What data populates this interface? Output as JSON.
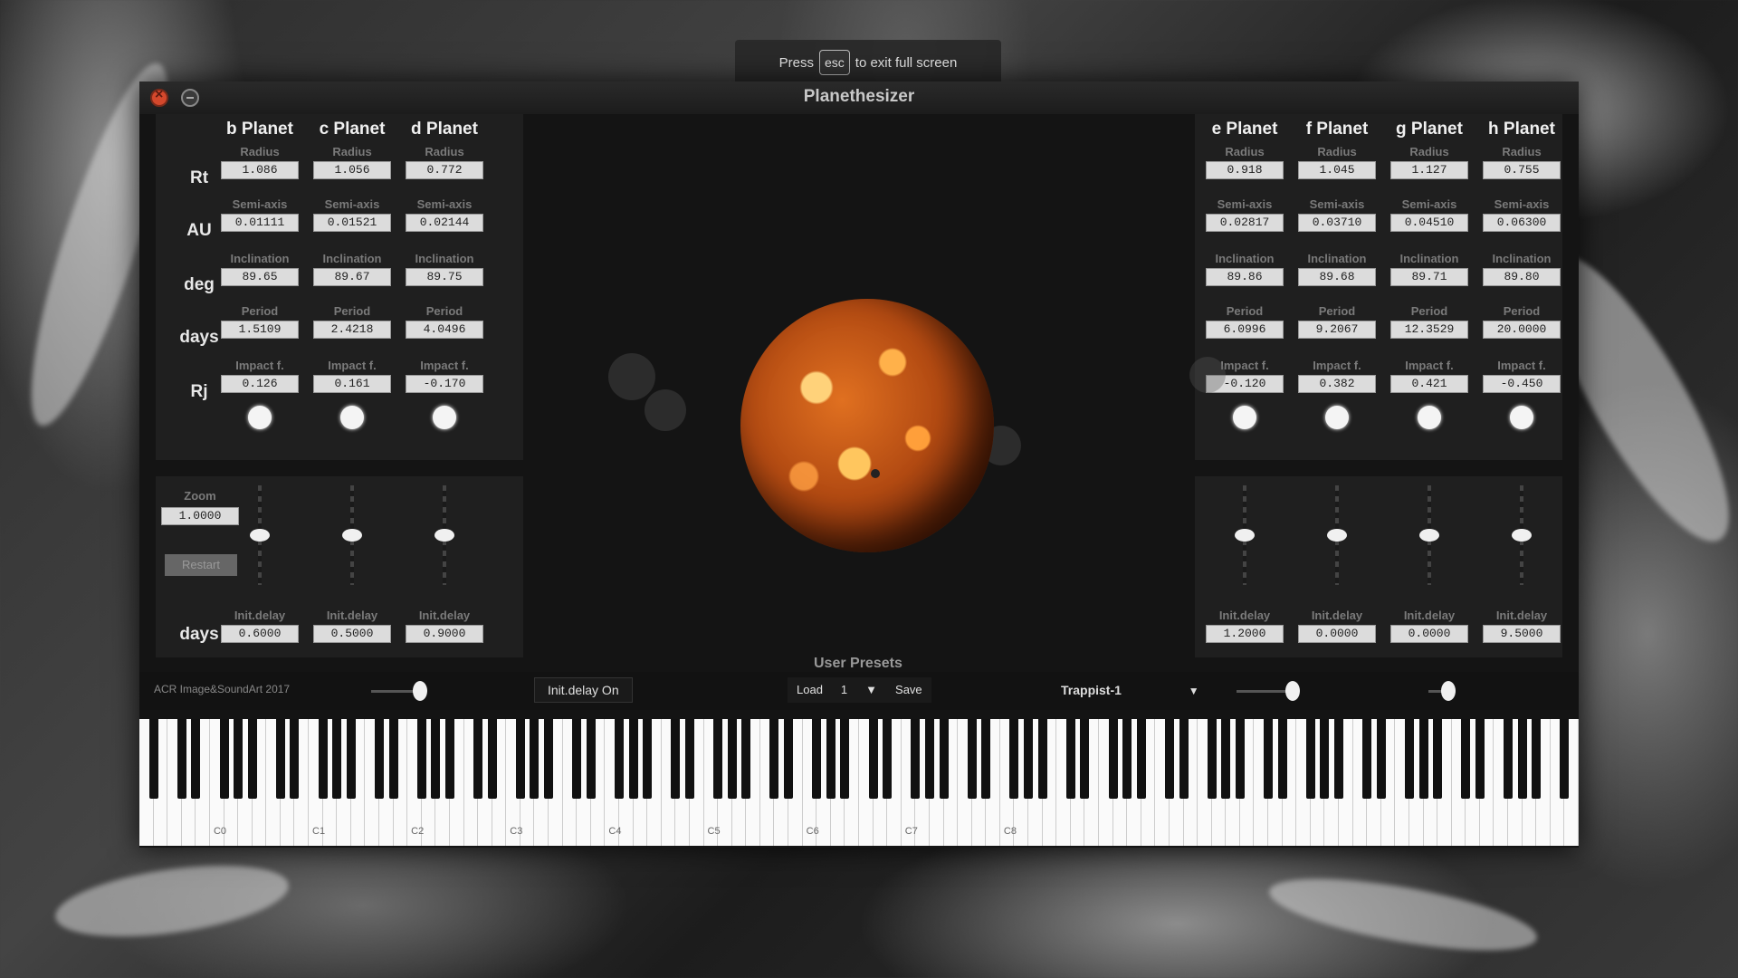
{
  "fullscreen_notice": {
    "press": "Press",
    "key": "esc",
    "suffix": "to exit full screen"
  },
  "window": {
    "title": "Planethesizer"
  },
  "row_units": {
    "radius": "Rt",
    "semi_axis": "AU",
    "inclination": "deg",
    "period": "days",
    "impact": "Rj",
    "delay": "days"
  },
  "field_labels": {
    "radius": "Radius",
    "semi_axis": "Semi-axis",
    "inclination": "Inclination",
    "period": "Period",
    "impact": "Impact f.",
    "delay": "Init.delay"
  },
  "planets_left": [
    {
      "name": "b Planet",
      "radius": "1.086",
      "semi_axis": "0.01111",
      "inclination": "89.65",
      "period": "1.5109",
      "impact": "0.126",
      "delay": "0.6000",
      "slider_level": 0.5
    },
    {
      "name": "c Planet",
      "radius": "1.056",
      "semi_axis": "0.01521",
      "inclination": "89.67",
      "period": "2.4218",
      "impact": "0.161",
      "delay": "0.5000",
      "slider_level": 0.5
    },
    {
      "name": "d Planet",
      "radius": "0.772",
      "semi_axis": "0.02144",
      "inclination": "89.75",
      "period": "4.0496",
      "impact": "-0.170",
      "delay": "0.9000",
      "slider_level": 0.5
    }
  ],
  "planets_right": [
    {
      "name": "e Planet",
      "radius": "0.918",
      "semi_axis": "0.02817",
      "inclination": "89.86",
      "period": "6.0996",
      "impact": "-0.120",
      "delay": "1.2000",
      "slider_level": 0.5
    },
    {
      "name": "f Planet",
      "radius": "1.045",
      "semi_axis": "0.03710",
      "inclination": "89.68",
      "period": "9.2067",
      "impact": "0.382",
      "delay": "0.0000",
      "slider_level": 0.5
    },
    {
      "name": "g Planet",
      "radius": "1.127",
      "semi_axis": "0.04510",
      "inclination": "89.71",
      "period": "12.3529",
      "impact": "0.421",
      "delay": "0.0000",
      "slider_level": 0.5
    },
    {
      "name": "h Planet",
      "radius": "0.755",
      "semi_axis": "0.06300",
      "inclination": "89.80",
      "period": "20.0000",
      "impact": "-0.450",
      "delay": "9.5000",
      "slider_level": 0.5
    }
  ],
  "zoom": {
    "label": "Zoom",
    "value": "1.0000"
  },
  "restart_label": "Restart",
  "bottom": {
    "copyright": "ACR Image&SoundArt 2017",
    "init_delay_toggle": "Init.delay On",
    "user_presets_label": "User Presets",
    "load_label": "Load",
    "preset_number": "1",
    "save_label": "Save",
    "preset_name": "Trappist-1"
  },
  "keyboard": {
    "octave_labels": [
      "C0",
      "C1",
      "C2",
      "C3",
      "C4",
      "C5",
      "C6",
      "C7",
      "C8"
    ]
  },
  "colors": {
    "planet_orange": "#d86a1e",
    "panel_bg": "#1f1f1f",
    "window_bg": "#141414"
  }
}
